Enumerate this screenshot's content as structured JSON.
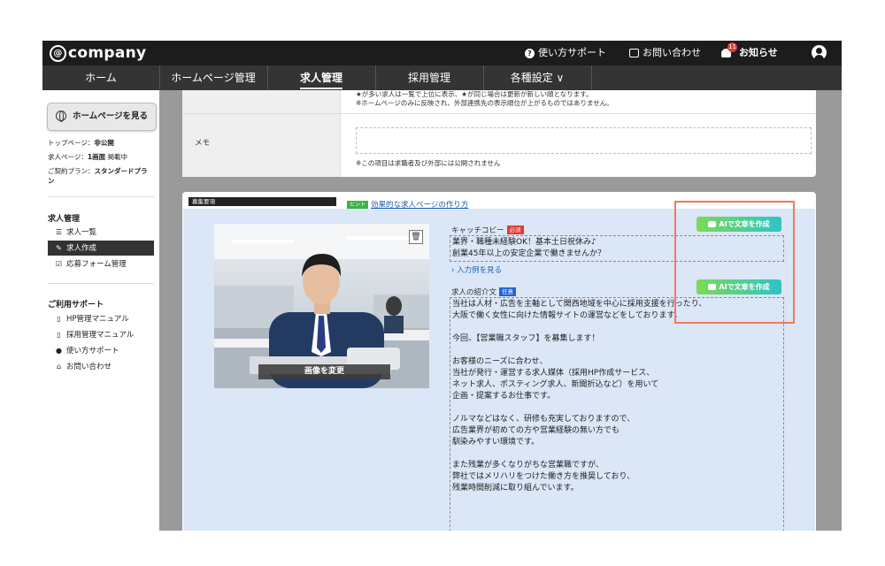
{
  "app": {
    "logo": "company",
    "topbar": {
      "support": "使い方サポート",
      "contact": "お問い合わせ",
      "notice": "お知らせ",
      "notice_count": "11"
    }
  },
  "nav": {
    "items": [
      {
        "label": "ホーム"
      },
      {
        "label": "ホームページ管理"
      },
      {
        "label": "求人管理"
      },
      {
        "label": "採用管理"
      },
      {
        "label": "各種設定 ∨"
      }
    ]
  },
  "sidebar": {
    "view_hp_button": "ホームページを見る",
    "top_page_label": "トップページ：",
    "top_page_value": "非公開",
    "job_page_label": "求人ページ：",
    "job_page_value": "1画面",
    "job_page_suffix": " 掲載中",
    "plan_label": "ご契約プラン：",
    "plan_value": "スタンダードプラン",
    "job_mgmt_title": "求人管理",
    "job_items": [
      {
        "label": "求人一覧",
        "icon": "list-icon"
      },
      {
        "label": "求人作成",
        "icon": "edit-icon"
      },
      {
        "label": "応募フォーム管理",
        "icon": "checkbox-icon"
      }
    ],
    "support_title": "ご利用サポート",
    "support_items": [
      {
        "label": "HP管理マニュアル",
        "icon": "document-icon"
      },
      {
        "label": "採用管理マニュアル",
        "icon": "document-icon"
      },
      {
        "label": "使い方サポート",
        "icon": "question-icon"
      },
      {
        "label": "お問い合わせ",
        "icon": "home-icon"
      }
    ]
  },
  "card_top": {
    "note_line1": "★が多い求人は一覧で上位に表示、★が同じ場合は更新が新しい順となります。",
    "note_line2": "※ホームページのみに反映され、外部連携先の表示順位が上がるものではありません。",
    "memo_label": "メモ",
    "memo_value": "",
    "memo_note": "※この項目は求職者及び外部には公開されません"
  },
  "card_recruit": {
    "section_tag": "募集要項",
    "hint_badge": "ヒント",
    "hint_link": "効果的な求人ページの作り方",
    "change_image_button": "画像を変更",
    "catch_label": "キャッチコピー",
    "required_badge": "必須",
    "ai_button": "AIで文章を作成",
    "catch_text": "業界・職種未経験OK！基本土日祝休み♪\n創業45年以上の安定企業で働きませんか？",
    "example_link": "入力例を見る",
    "intro_label": "求人の紹介文",
    "optional_badge": "任意",
    "intro_text": "当社は人材・広告を主軸として関西地域を中心に採用支援を行ったり、\n大阪で働く女性に向けた情報サイトの運営などをしております。\n\n今回、【営業職スタッフ】を募集します！\n\nお客様のニーズに合わせ、\n当社が発行・運営する求人媒体（採用HP作成サービス、\nネット求人、ポスティング求人、新聞折込など）を用いて\n企画・提案するお仕事です。\n\nノルマなどはなく、研修も充実しておりますので、\n広告業界が初めての方や営業経験の無い方でも\n馴染みやすい環境です。\n\nまた残業が多くなりがちな営業職ですが、\n弊社ではメリハリをつけた働き方を推奨しており、\n残業時間削減に取り組んでいます。"
  },
  "colors": {
    "topbar": "#1c1c1c",
    "navbar": "#343434",
    "blue_area": "#dbe6f7",
    "required": "#e53935",
    "optional": "#2563d6",
    "ai_gradient_start": "#7ed957",
    "ai_gradient_end": "#2ec4c6",
    "highlight": "#f07a57"
  }
}
